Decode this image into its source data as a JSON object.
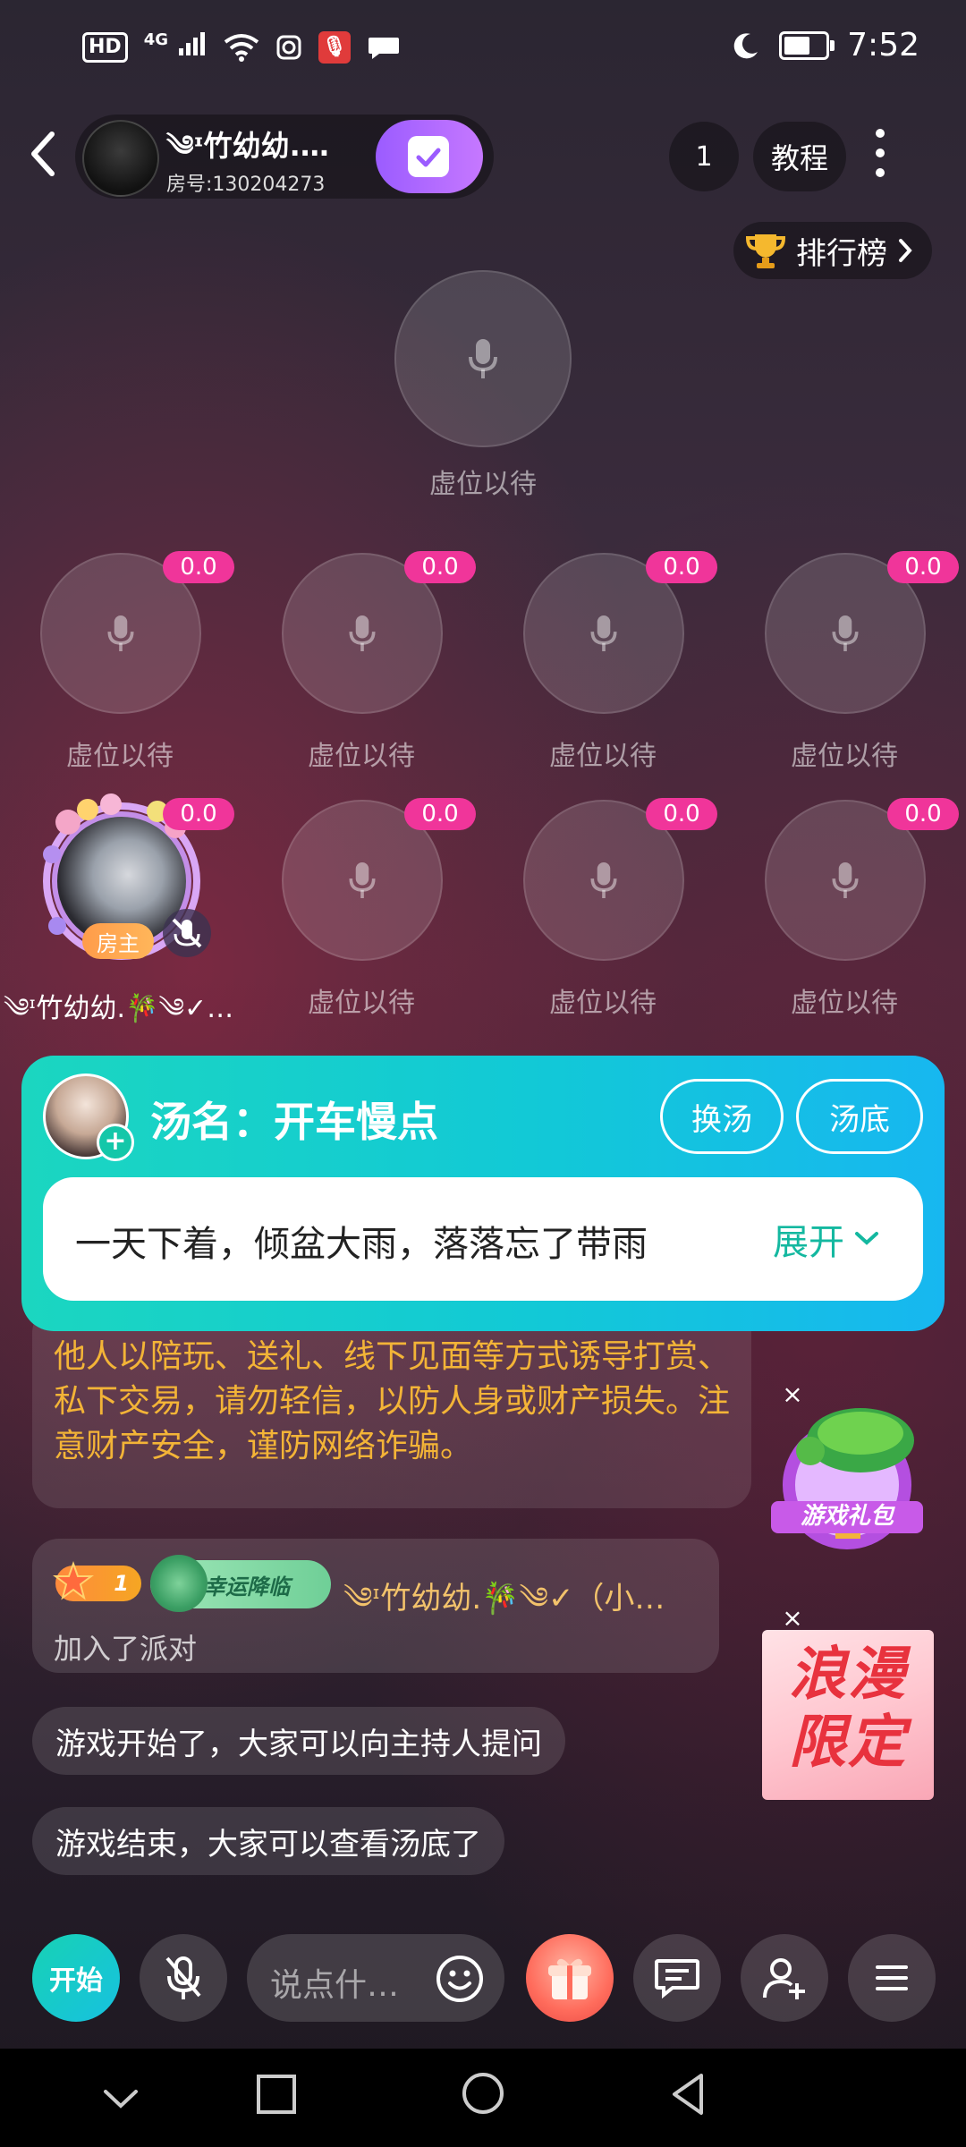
{
  "status_bar": {
    "hd": "HD",
    "network": "4G",
    "time": "7:52"
  },
  "header": {
    "room_name": "༄ᶦ竹幼幼.…",
    "room_id": "房号:130204273",
    "online_count": "1",
    "tutorial_label": "教程",
    "rank_label": "排行榜"
  },
  "seats": {
    "host": {
      "label": "虚位以待"
    },
    "row1": [
      {
        "label": "虚位以待",
        "score": "0.0"
      },
      {
        "label": "虚位以待",
        "score": "0.0"
      },
      {
        "label": "虚位以待",
        "score": "0.0"
      },
      {
        "label": "虚位以待",
        "score": "0.0"
      }
    ],
    "row2": [
      {
        "label": "༄ᶦ竹幼幼.🎋༄✓…",
        "score": "0.0",
        "badge": "房主"
      },
      {
        "label": "虚位以待",
        "score": "0.0"
      },
      {
        "label": "虚位以待",
        "score": "0.0"
      },
      {
        "label": "虚位以待",
        "score": "0.0"
      }
    ]
  },
  "soup": {
    "title": "汤名：开车慢点",
    "change_label": "换汤",
    "answer_label": "汤底",
    "content": "一天下着，倾盆大雨，落落忘了带雨",
    "expand_label": "展开"
  },
  "chat": {
    "notice": "现违法违规、低俗色情、赌博涉政等内容。如遇他人以陪玩、送礼、线下见面等方式诱导打赏、私下交易，请勿轻信，以防人身或财产损失。注意财产安全，谨防网络诈骗。",
    "join": {
      "level": "1",
      "luck_badge": "幸运降临",
      "name": "༄ᶦ竹幼幼.🎋༄✓（小…",
      "action": "加入了派对"
    },
    "messages": [
      "游戏开始了，大家可以向主持人提问",
      "游戏结束，大家可以查看汤底了"
    ]
  },
  "promos": {
    "game_gift": "游戏礼包",
    "romance_line1": "浪漫",
    "romance_line2": "限定"
  },
  "bottom_bar": {
    "start_label": "开始",
    "input_placeholder": "说点什…"
  },
  "colors": {
    "accent_teal": "#17d2b4",
    "score_pink": "#f0359a",
    "notice_gold": "#f3b437",
    "check_purple": "#9b5cff"
  }
}
